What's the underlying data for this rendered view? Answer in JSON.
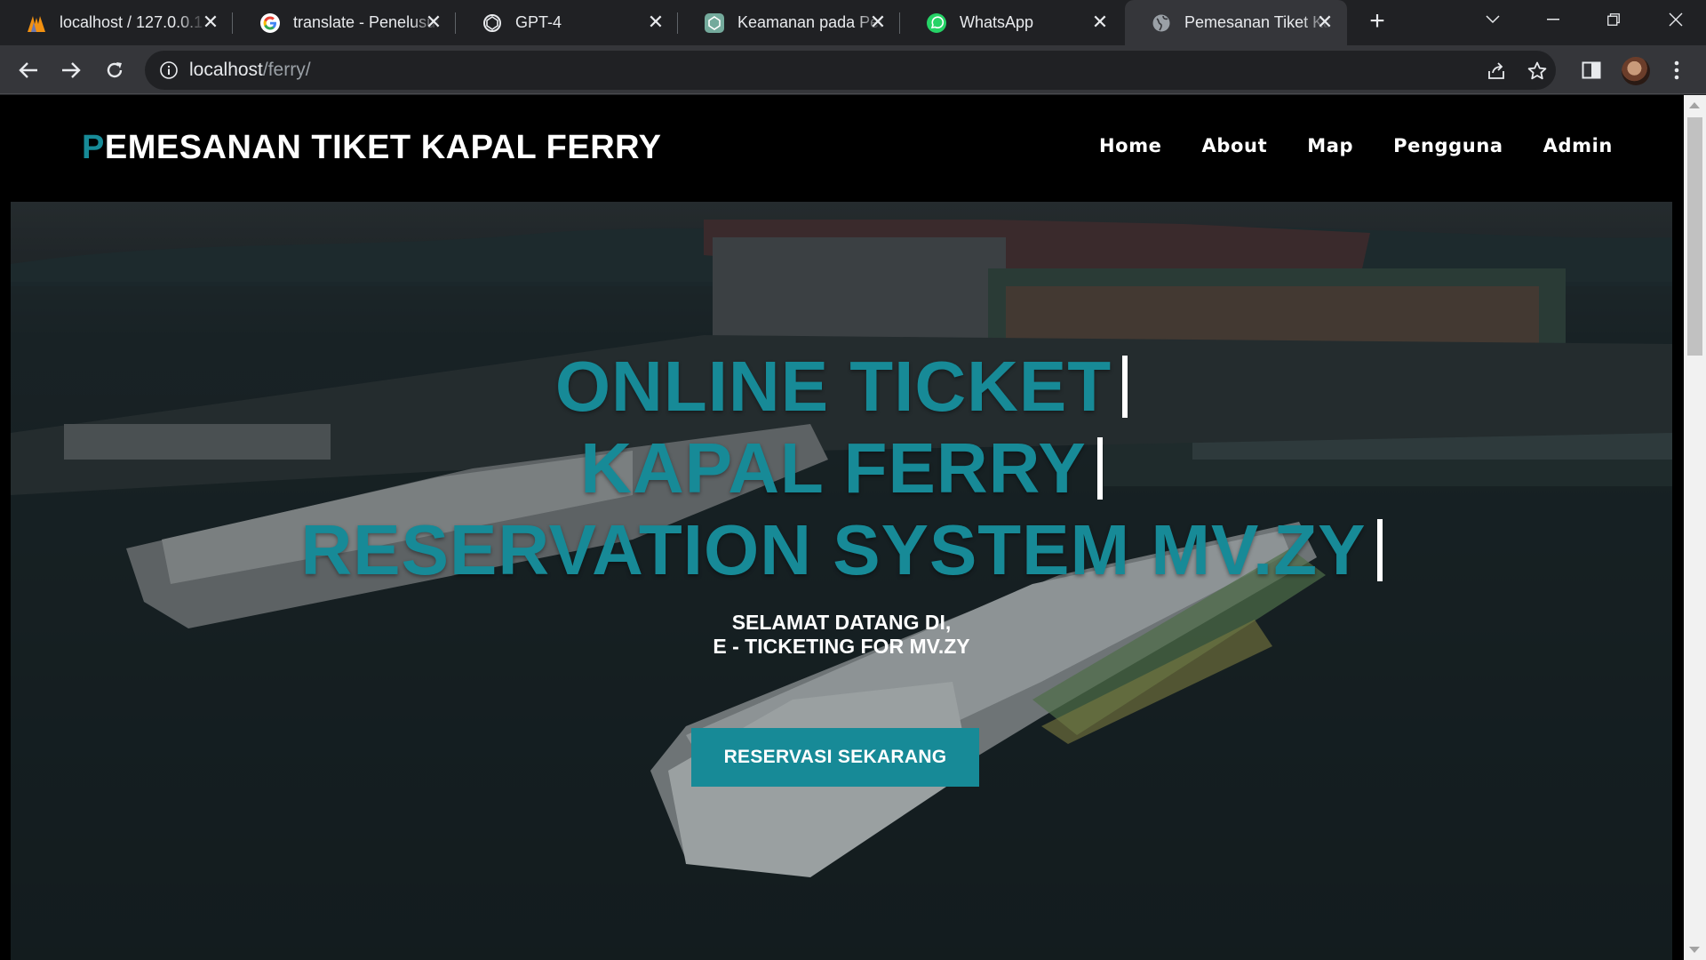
{
  "browser": {
    "tabs": [
      {
        "title": "localhost / 127.0.0.1",
        "icon": "phpmyadmin-icon"
      },
      {
        "title": "translate - Penelusuran",
        "icon": "google-icon"
      },
      {
        "title": "GPT-4",
        "icon": "openai-icon"
      },
      {
        "title": "Keamanan pada Pengiriman",
        "icon": "chatgpt-icon"
      },
      {
        "title": "WhatsApp",
        "icon": "whatsapp-icon"
      },
      {
        "title": "Pemesanan Tiket Kapal",
        "icon": "globe-icon",
        "active": true
      }
    ],
    "url": {
      "host": "localhost",
      "path": "/ferry/"
    }
  },
  "site": {
    "brand": {
      "first_letter": "P",
      "rest": "EMESANAN TIKET KAPAL FERRY"
    },
    "nav": [
      "Home",
      "About",
      "Map",
      "Pengguna",
      "Admin"
    ],
    "hero": {
      "lines": [
        "ONLINE TICKET",
        "KAPAL FERRY",
        "RESERVATION SYSTEM MV.ZY"
      ],
      "welcome_1": "SELAMAT DATANG DI,",
      "welcome_2": "E - TICKETING FOR MV.ZY",
      "cta_label": "RESERVASI SEKARANG"
    }
  },
  "colors": {
    "accent": "#178a97",
    "chrome_dark": "#202124",
    "chrome_toolbar": "#35363a"
  }
}
